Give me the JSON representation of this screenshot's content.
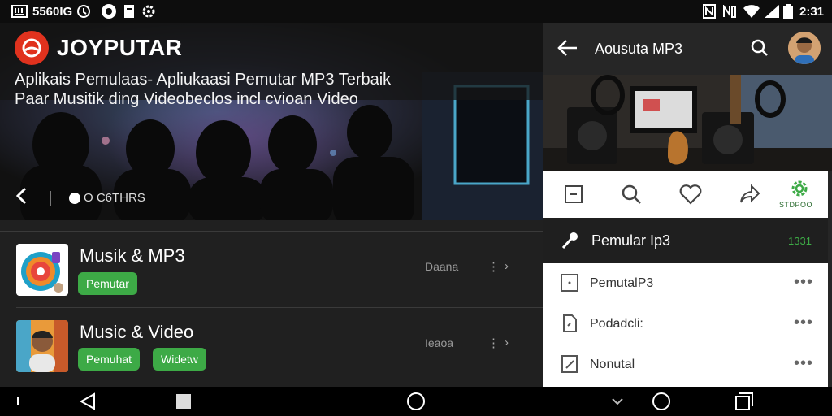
{
  "status_bar": {
    "left_text": "5560IG",
    "time": "2:31"
  },
  "main": {
    "brand_name": "JOYPUTAR",
    "headline_line1": "Aplikais Pemulaas- Apliukaasi Pemutar MP3 Terbaik",
    "headline_line2": "Paar Musitik ding Videobeclos incl cvioan Video",
    "hero_label": "O C6THRS",
    "apps": [
      {
        "title": "Musik & MP3",
        "tags": [
          "Pemutar"
        ],
        "meta": "Daana",
        "dots": "⋮",
        "chevron": "›"
      },
      {
        "title": "Music & Video",
        "tags": [
          "Pemuhat",
          "Widetw"
        ],
        "meta": "Ieaoa",
        "dots": "⋮",
        "chevron": "›"
      }
    ]
  },
  "detail": {
    "title": "Aousuta MP3",
    "action_label": "STDPOO",
    "section_title": "Pemular Ip3",
    "section_count": "1331",
    "list_items": [
      {
        "label": "PemutalP3",
        "more": "•••"
      },
      {
        "label": "Podadcli:",
        "more": "•••"
      },
      {
        "label": "Nonutal",
        "more": "•••"
      }
    ]
  },
  "colors": {
    "accent_green": "#3daa46",
    "brand_red": "#e0321e",
    "panel_dark": "#202020"
  },
  "icons": [
    "back-arrow-icon",
    "search-icon",
    "heart-icon",
    "share-icon",
    "settings-icon",
    "microphone-icon",
    "menu-icon"
  ]
}
